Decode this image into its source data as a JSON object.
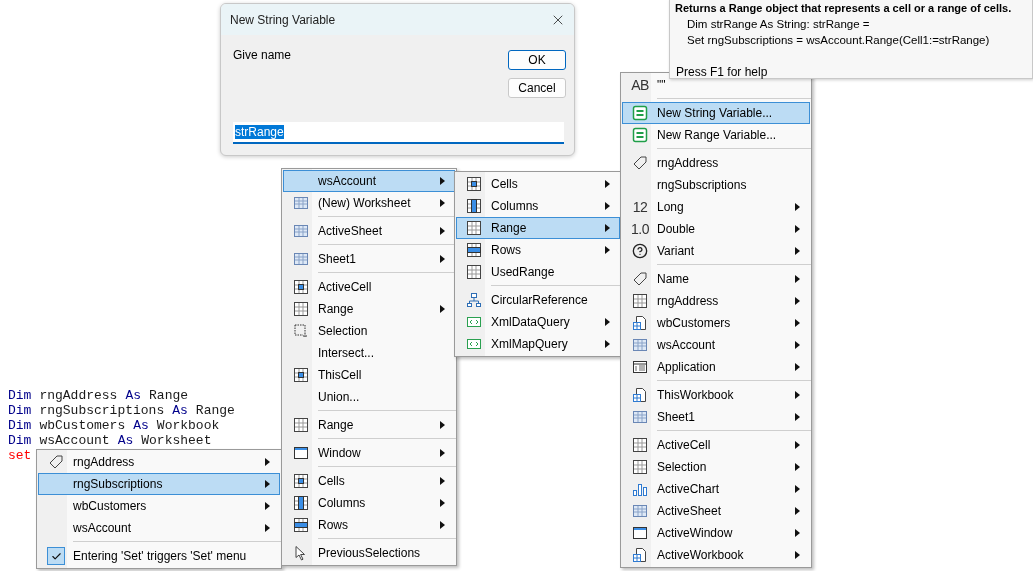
{
  "dialog": {
    "title": "New String Variable",
    "prompt": "Give name",
    "buttons": [
      {
        "label": "OK",
        "default": true
      },
      {
        "label": "Cancel",
        "default": false
      }
    ],
    "input": {
      "value": "strRange",
      "text_selected": true
    }
  },
  "tooltip": {
    "title": "Returns a Range object that represents a cell or a range of cells.",
    "lines": [
      "Dim strRange As String: strRange =",
      "Set rngSubscriptions = wsAccount.Range(Cell1:=strRange)"
    ],
    "footer": "Press F1 for help"
  },
  "code": {
    "lines": [
      {
        "tokens": [
          {
            "text": "Dim",
            "kind": "keyword"
          },
          {
            "text": "rngAddress",
            "kind": "ident"
          },
          {
            "text": "As",
            "kind": "keyword"
          },
          {
            "text": "Range",
            "kind": "ident"
          }
        ]
      },
      {
        "tokens": [
          {
            "text": "Dim",
            "kind": "keyword"
          },
          {
            "text": "rngSubscriptions",
            "kind": "ident"
          },
          {
            "text": "As",
            "kind": "keyword"
          },
          {
            "text": "Range",
            "kind": "ident"
          }
        ]
      },
      {
        "tokens": [
          {
            "text": "Dim",
            "kind": "keyword"
          },
          {
            "text": "wbCustomers",
            "kind": "ident"
          },
          {
            "text": "As",
            "kind": "keyword"
          },
          {
            "text": "Workbook",
            "kind": "ident"
          }
        ]
      },
      {
        "tokens": [
          {
            "text": "Dim",
            "kind": "keyword"
          },
          {
            "text": "wsAccount",
            "kind": "ident"
          },
          {
            "text": "As",
            "kind": "keyword"
          },
          {
            "text": "Worksheet",
            "kind": "ident"
          }
        ]
      },
      {
        "tokens": [
          {
            "text": "set",
            "kind": "error"
          }
        ]
      }
    ]
  },
  "menus": [
    {
      "groups": [
        [
          {
            "label": "rngAddress",
            "kind": "tag",
            "submenu": true,
            "selected": false
          },
          {
            "label": "rngSubscriptions",
            "kind": "plain",
            "submenu": true,
            "selected": true
          },
          {
            "label": "wbCustomers",
            "kind": "plain",
            "submenu": true,
            "selected": false
          },
          {
            "label": "wsAccount",
            "kind": "plain",
            "submenu": true,
            "selected": false
          }
        ],
        [
          {
            "label": "Entering 'Set' triggers 'Set' menu",
            "kind": "check",
            "submenu": false,
            "selected": false,
            "checked": true
          }
        ]
      ]
    },
    {
      "groups": [
        [
          {
            "label": "wsAccount",
            "kind": "plain",
            "submenu": true,
            "selected": true
          },
          {
            "label": "(New) Worksheet",
            "kind": "sheet",
            "submenu": true,
            "selected": false
          }
        ],
        [
          {
            "label": "ActiveSheet",
            "kind": "sheet",
            "submenu": true,
            "selected": false
          }
        ],
        [
          {
            "label": "Sheet1",
            "kind": "sheet",
            "submenu": true,
            "selected": false
          }
        ],
        [
          {
            "label": "ActiveCell",
            "kind": "cell",
            "submenu": false,
            "selected": false
          },
          {
            "label": "Range",
            "kind": "grid",
            "submenu": true,
            "selected": false
          },
          {
            "label": "Selection",
            "kind": "selection",
            "submenu": false,
            "selected": false
          },
          {
            "label": "Intersect...",
            "kind": "plain",
            "submenu": false,
            "selected": false
          },
          {
            "label": "ThisCell",
            "kind": "cell",
            "submenu": false,
            "selected": false
          },
          {
            "label": "Union...",
            "kind": "plain",
            "submenu": false,
            "selected": false
          }
        ],
        [
          {
            "label": "Range",
            "kind": "grid",
            "submenu": true,
            "selected": false
          }
        ],
        [
          {
            "label": "Window",
            "kind": "window",
            "submenu": true,
            "selected": false
          }
        ],
        [
          {
            "label": "Cells",
            "kind": "cell",
            "submenu": true,
            "selected": false
          },
          {
            "label": "Columns",
            "kind": "column",
            "submenu": true,
            "selected": false
          },
          {
            "label": "Rows",
            "kind": "row",
            "submenu": true,
            "selected": false
          }
        ],
        [
          {
            "label": "PreviousSelections",
            "kind": "pointer",
            "submenu": false,
            "selected": false
          }
        ]
      ]
    },
    {
      "groups": [
        [
          {
            "label": "Cells",
            "kind": "cell",
            "submenu": true,
            "selected": false
          },
          {
            "label": "Columns",
            "kind": "column",
            "submenu": true,
            "selected": false
          },
          {
            "label": "Range",
            "kind": "grid",
            "submenu": true,
            "selected": true
          },
          {
            "label": "Rows",
            "kind": "row",
            "submenu": true,
            "selected": false
          },
          {
            "label": "UsedRange",
            "kind": "grid",
            "submenu": false,
            "selected": false
          }
        ],
        [
          {
            "label": "CircularReference",
            "kind": "tree",
            "submenu": false,
            "selected": false
          },
          {
            "label": "XmlDataQuery",
            "kind": "xml",
            "submenu": true,
            "selected": false
          },
          {
            "label": "XmlMapQuery",
            "kind": "xml",
            "submenu": true,
            "selected": false
          }
        ]
      ]
    },
    {
      "groups": [
        [
          {
            "label": "\"\"",
            "kind": "glyph",
            "glyph": "AB",
            "submenu": false,
            "selected": false
          }
        ],
        [
          {
            "label": "New String Variable...",
            "kind": "variable",
            "submenu": false,
            "selected": true
          },
          {
            "label": "New Range Variable...",
            "kind": "variable",
            "submenu": false,
            "selected": false
          }
        ],
        [
          {
            "label": "rngAddress",
            "kind": "tag",
            "submenu": false,
            "selected": false
          },
          {
            "label": "rngSubscriptions",
            "kind": "plain",
            "submenu": false,
            "selected": false
          },
          {
            "label": "Long",
            "kind": "glyph",
            "glyph": "12",
            "submenu": true,
            "selected": false
          },
          {
            "label": "Double",
            "kind": "glyph",
            "glyph": "1.0",
            "submenu": true,
            "selected": false
          },
          {
            "label": "Variant",
            "kind": "question",
            "submenu": true,
            "selected": false
          }
        ],
        [
          {
            "label": "Name",
            "kind": "tag",
            "submenu": true,
            "selected": false
          },
          {
            "label": "rngAddress",
            "kind": "grid",
            "submenu": true,
            "selected": false
          },
          {
            "label": "wbCustomers",
            "kind": "workbook",
            "submenu": true,
            "selected": false
          },
          {
            "label": "wsAccount",
            "kind": "sheet",
            "submenu": true,
            "selected": false
          },
          {
            "label": "Application",
            "kind": "application",
            "submenu": true,
            "selected": false
          }
        ],
        [
          {
            "label": "ThisWorkbook",
            "kind": "workbook",
            "submenu": true,
            "selected": false
          },
          {
            "label": "Sheet1",
            "kind": "sheet",
            "submenu": true,
            "selected": false
          }
        ],
        [
          {
            "label": "ActiveCell",
            "kind": "grid",
            "submenu": true,
            "selected": false
          },
          {
            "label": "Selection",
            "kind": "grid",
            "submenu": true,
            "selected": false
          },
          {
            "label": "ActiveChart",
            "kind": "chart",
            "submenu": true,
            "selected": false
          },
          {
            "label": "ActiveSheet",
            "kind": "sheet",
            "submenu": true,
            "selected": false
          },
          {
            "label": "ActiveWindow",
            "kind": "window",
            "submenu": true,
            "selected": false
          },
          {
            "label": "ActiveWorkbook",
            "kind": "workbook",
            "submenu": true,
            "selected": false
          }
        ]
      ]
    }
  ]
}
